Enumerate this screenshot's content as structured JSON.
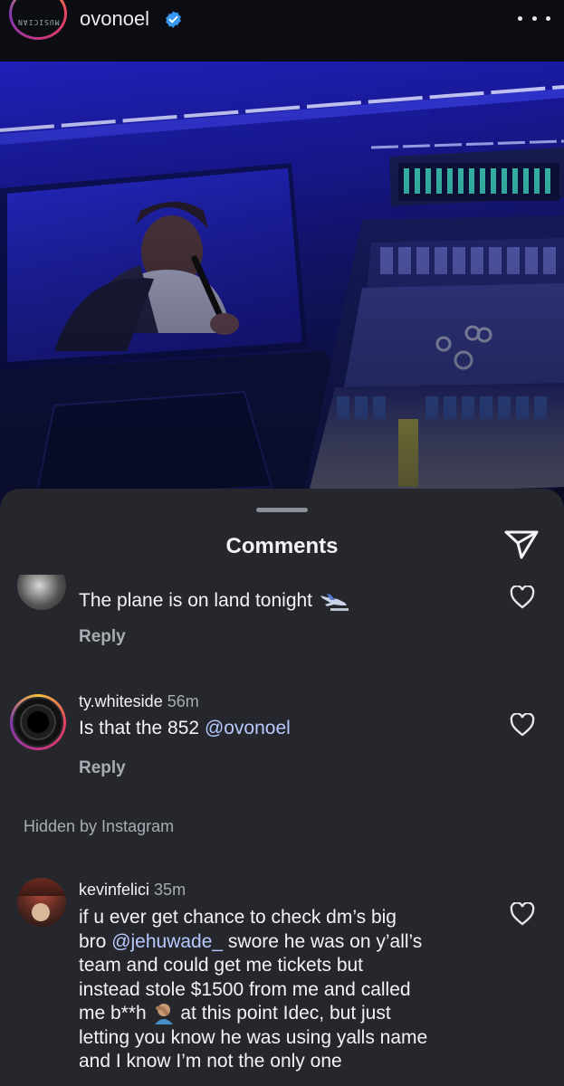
{
  "post": {
    "username": "ovonoel",
    "avatar_text": "MUSICIAN"
  },
  "comments_sheet": {
    "title": "Comments",
    "hidden_notice": "Hidden by Instagram",
    "comments": [
      {
        "username": "",
        "time": "",
        "text": "The plane is on land tonight",
        "emoji": "airplane-landing",
        "reply_label": "Reply"
      },
      {
        "username": "ty.whiteside",
        "time": "56m",
        "text_prefix": "Is that the 852 ",
        "mention": "@ovonoel",
        "reply_label": "Reply"
      },
      {
        "username": "kevinfelici",
        "time": "35m",
        "line1": "if u ever get chance to check dm’s big",
        "line2_prefix": "bro ",
        "line2_mention": "@jehuwade_",
        "line2_suffix": " swore he was on y’all’s",
        "line3": "team and could get me tickets but",
        "line4": "instead stole $1500 from me and called",
        "line5_prefix": "me b**h ",
        "line5_emoji": "person-facepalming",
        "line5_suffix": " at this point Idec, but just",
        "line6": "letting you know he was using yalls name",
        "line7": "and I know I’m not the only one"
      }
    ]
  },
  "colors": {
    "sheet_bg": "#25272c",
    "mention": "#b7c9ff",
    "verified": "#3897f0"
  }
}
